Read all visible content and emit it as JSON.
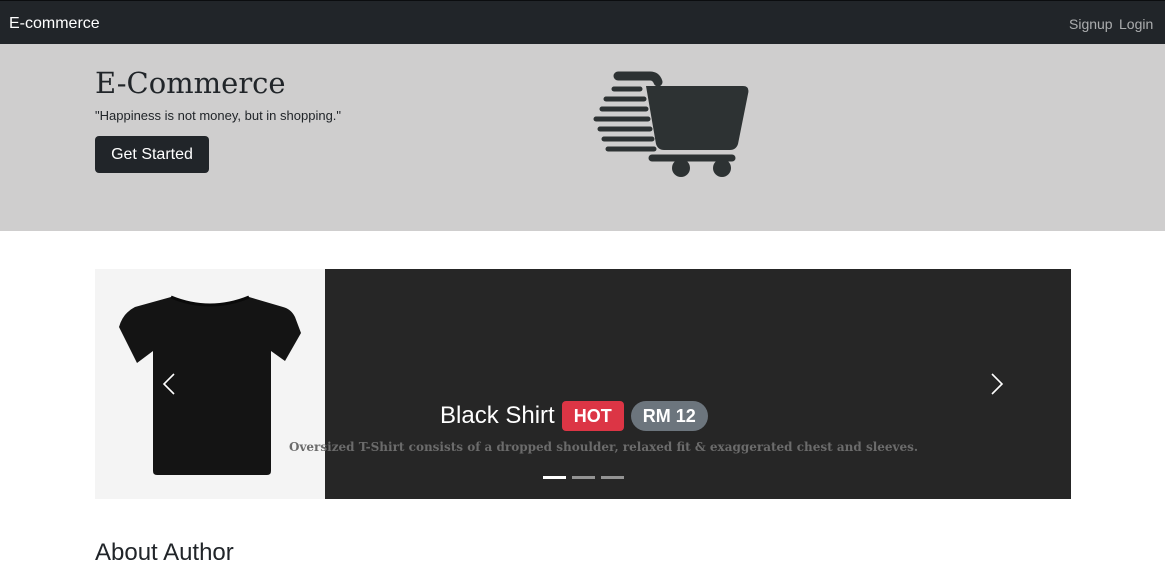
{
  "navbar": {
    "brand": "E-commerce",
    "links": [
      {
        "label": "Signup"
      },
      {
        "label": "Login"
      }
    ]
  },
  "hero": {
    "title": "E-Commerce",
    "quote": "\"Happiness is not money, but in shopping.\"",
    "button_label": "Get Started",
    "logo_icon": "fast-shopping-cart-icon"
  },
  "carousel": {
    "slide": {
      "title": "Black Shirt",
      "badge": "HOT",
      "price": "RM 12",
      "description": "Oversized T-Shirt consists of a dropped shoulder, relaxed fit & exaggerated chest and sleeves.",
      "image_icon": "black-tshirt-image"
    },
    "slide_count": 3,
    "active_index": 0,
    "prev_icon": "chevron-left-icon",
    "next_icon": "chevron-right-icon"
  },
  "about": {
    "heading": "About Author"
  },
  "colors": {
    "navbar_bg": "#212529",
    "hero_bg": "#cfcece",
    "carousel_bg": "#262626",
    "badge_hot": "#dc3545",
    "badge_price": "#6c757d"
  }
}
